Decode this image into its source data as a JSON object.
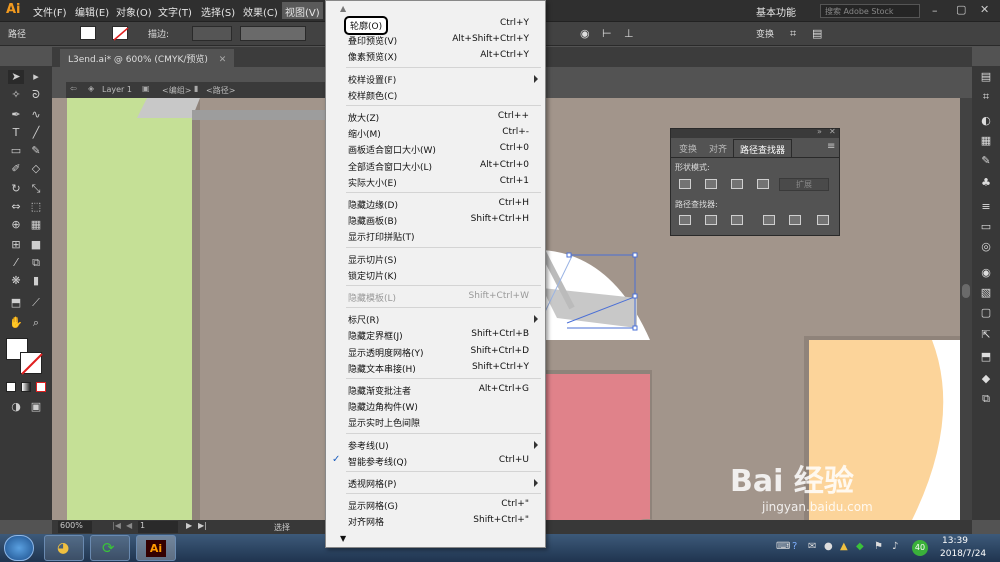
{
  "app": {
    "logo": "Ai"
  },
  "menubar": {
    "items": [
      "文件(F)",
      "编辑(E)",
      "对象(O)",
      "文字(T)",
      "选择(S)",
      "效果(C)",
      "视图(V)"
    ],
    "workspace": "基本功能",
    "search_placeholder": "搜索 Adobe Stock"
  },
  "controlbar": {
    "selection": "路径",
    "stroke_label": "描边:",
    "transform": "变换"
  },
  "document": {
    "tab": "L3end.ai* @ 600% (CMYK/预览)",
    "breadcrumb": [
      "Layer 1",
      "<编组>",
      "<路径>"
    ]
  },
  "pathfinder": {
    "tabs": [
      "变换",
      "对齐",
      "路径查找器"
    ],
    "shape_modes_label": "形状模式:",
    "pathfinders_label": "路径查找器:",
    "expand": "扩展"
  },
  "status": {
    "zoom": "600%",
    "page": "1",
    "tool": "选择"
  },
  "taskbar": {
    "time": "13:39",
    "date": "2018/7/24",
    "badge": "40"
  },
  "watermark": {
    "brand": "Bai 经验",
    "url": "jingyan.baidu.com"
  },
  "view_menu": {
    "items": [
      {
        "label": "轮廓(O)",
        "shortcut": "Ctrl+Y",
        "boxed": true
      },
      {
        "label": "叠印预览(V)",
        "shortcut": "Alt+Shift+Ctrl+Y"
      },
      {
        "label": "像素预览(X)",
        "shortcut": "Alt+Ctrl+Y"
      },
      {
        "sep": true
      },
      {
        "label": "校样设置(F)",
        "shortcut": "",
        "submenu": true
      },
      {
        "label": "校样颜色(C)",
        "shortcut": ""
      },
      {
        "sep": true
      },
      {
        "label": "放大(Z)",
        "shortcut": "Ctrl++"
      },
      {
        "label": "缩小(M)",
        "shortcut": "Ctrl+-"
      },
      {
        "label": "画板适合窗口大小(W)",
        "shortcut": "Ctrl+0"
      },
      {
        "label": "全部适合窗口大小(L)",
        "shortcut": "Alt+Ctrl+0"
      },
      {
        "label": "实际大小(E)",
        "shortcut": "Ctrl+1"
      },
      {
        "sep": true
      },
      {
        "label": "隐藏边缘(D)",
        "shortcut": "Ctrl+H"
      },
      {
        "label": "隐藏画板(B)",
        "shortcut": "Shift+Ctrl+H"
      },
      {
        "label": "显示打印拼贴(T)",
        "shortcut": ""
      },
      {
        "sep": true
      },
      {
        "label": "显示切片(S)",
        "shortcut": ""
      },
      {
        "label": "锁定切片(K)",
        "shortcut": ""
      },
      {
        "sep": true
      },
      {
        "label": "隐藏模板(L)",
        "shortcut": "Shift+Ctrl+W",
        "disabled": true
      },
      {
        "sep": true
      },
      {
        "label": "标尺(R)",
        "shortcut": "",
        "submenu": true
      },
      {
        "label": "隐藏定界框(J)",
        "shortcut": "Shift+Ctrl+B"
      },
      {
        "label": "显示透明度网格(Y)",
        "shortcut": "Shift+Ctrl+D"
      },
      {
        "label": "隐藏文本串接(H)",
        "shortcut": "Shift+Ctrl+Y"
      },
      {
        "sep": true
      },
      {
        "label": "隐藏渐变批注者",
        "shortcut": "Alt+Ctrl+G"
      },
      {
        "label": "隐藏边角构件(W)",
        "shortcut": ""
      },
      {
        "label": "显示实时上色间隙",
        "shortcut": ""
      },
      {
        "sep": true
      },
      {
        "label": "参考线(U)",
        "shortcut": "",
        "submenu": true
      },
      {
        "label": "智能参考线(Q)",
        "shortcut": "Ctrl+U",
        "checked": true
      },
      {
        "sep": true
      },
      {
        "label": "透视网格(P)",
        "shortcut": "",
        "submenu": true
      },
      {
        "sep": true
      },
      {
        "label": "显示网格(G)",
        "shortcut": "Ctrl+\""
      },
      {
        "label": "对齐网格",
        "shortcut": "Shift+Ctrl+\""
      }
    ]
  },
  "colors": {
    "canvas": "#a2958b",
    "green": "#c5e096",
    "pink": "#e0828a",
    "orange": "#fcd49a",
    "selection": "#4a6fd6"
  }
}
